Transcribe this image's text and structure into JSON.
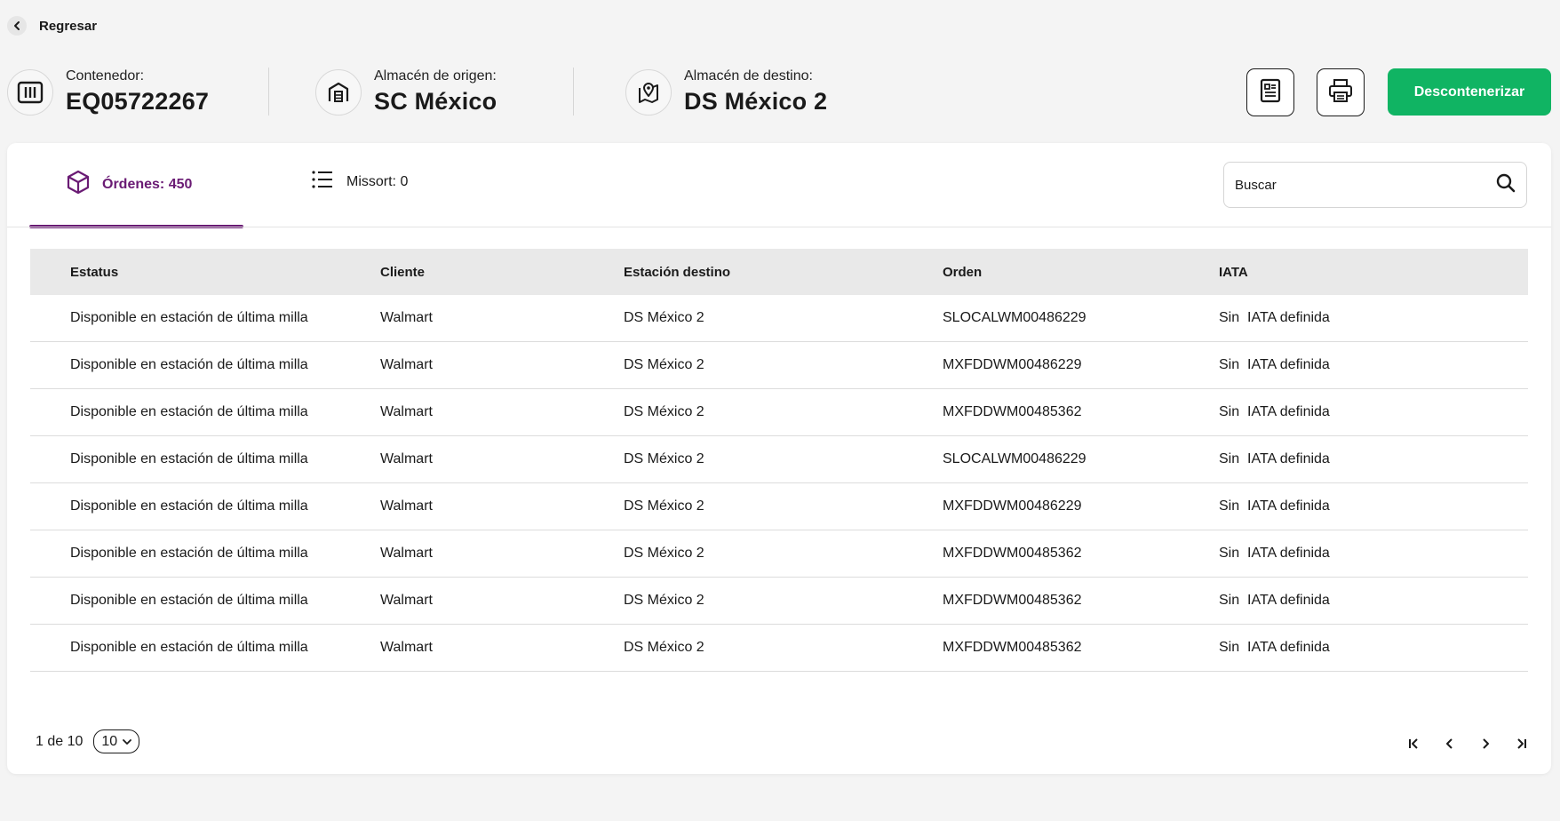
{
  "back": {
    "label": "Regresar"
  },
  "header": {
    "container": {
      "label": "Contenedor:",
      "value": "EQ05722267"
    },
    "origin": {
      "label": "Almacén de origen:",
      "value": "SC México"
    },
    "destination": {
      "label": "Almacén de destino:",
      "value": "DS México 2"
    },
    "actions": {
      "report_icon": "document-icon",
      "print_icon": "printer-icon",
      "primary_label": "Descontenerizar",
      "primary_color": "#10b463"
    }
  },
  "tabs": [
    {
      "label": "Órdenes: 450",
      "icon": "box-icon",
      "active": true,
      "color": "#6a1b74"
    },
    {
      "label": "Missort: 0",
      "icon": "list-icon",
      "active": false
    }
  ],
  "search": {
    "placeholder": "Buscar",
    "value": ""
  },
  "table": {
    "columns": [
      "Estatus",
      "Cliente",
      "Estación destino",
      "Orden",
      "IATA"
    ],
    "rows": [
      [
        "Disponible en estación de última milla",
        "Walmart",
        "DS México 2",
        "SLOCALWM00486229",
        "Sin  IATA definida"
      ],
      [
        "Disponible en estación de última milla",
        "Walmart",
        "DS México 2",
        "MXFDDWM00486229",
        "Sin  IATA definida"
      ],
      [
        "Disponible en estación de última milla",
        "Walmart",
        "DS México 2",
        "MXFDDWM00485362",
        "Sin  IATA definida"
      ],
      [
        "Disponible en estación de última milla",
        "Walmart",
        "DS México 2",
        "SLOCALWM00486229",
        "Sin  IATA definida"
      ],
      [
        "Disponible en estación de última milla",
        "Walmart",
        "DS México 2",
        "MXFDDWM00486229",
        "Sin  IATA definida"
      ],
      [
        "Disponible en estación de última milla",
        "Walmart",
        "DS México 2",
        "MXFDDWM00485362",
        "Sin  IATA definida"
      ],
      [
        "Disponible en estación de última milla",
        "Walmart",
        "DS México 2",
        "MXFDDWM00485362",
        "Sin  IATA definida"
      ],
      [
        "Disponible en estación de última milla",
        "Walmart",
        "DS México 2",
        "MXFDDWM00485362",
        "Sin  IATA definida"
      ]
    ]
  },
  "pagination": {
    "range_text": "1 de 10",
    "page_size": "10"
  }
}
